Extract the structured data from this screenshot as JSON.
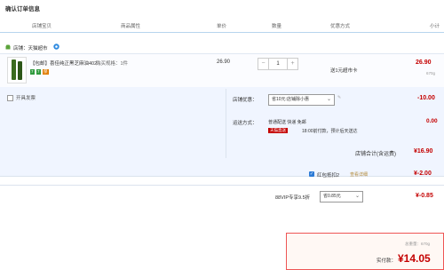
{
  "page": {
    "title": "确认订单信息"
  },
  "table_header": {
    "col_shop": "店铺宝贝",
    "col_attr": "商品属性",
    "col_price": "单价",
    "col_qty": "数量",
    "col_promo": "优惠方式",
    "col_subtotal": "小计"
  },
  "shop": {
    "label": "店铺：天猫超市"
  },
  "item": {
    "name": "【包邮】喜佳纯正黑芝麻油402...",
    "spec": "购买规格：1件",
    "badges": [
      "7",
      "7",
      "保"
    ],
    "price": "26.90",
    "qty": "1",
    "promo": "送1元超市卡",
    "subtotal": "26.90",
    "weight": "670g"
  },
  "options": {
    "invoice": "开具发票",
    "shop_discount_label": "店铺优惠：",
    "shop_discount_value": "省10元:店铺除小惠",
    "shop_discount_amount": "-10.00",
    "shipping_label": "运送方式：",
    "shipping_line1": "普通配送 快递 免邮",
    "shipping_tag": "天猫直送",
    "shipping_line2": "18:00前付款，预计后天送达",
    "shipping_fee": "0.00"
  },
  "shop_total": {
    "label": "店铺合计(含运费)",
    "value": "¥16.90"
  },
  "redpacket": {
    "label": "红包抵扣2",
    "sub": "查看详细",
    "value": "¥-2.00"
  },
  "vip": {
    "label": "88VIP专享9.5折",
    "select": "省0.85元",
    "value": "¥-0.85"
  },
  "summary": {
    "weight": "总重量：670g",
    "pay_label": "实付款：",
    "pay_value": "¥14.05"
  }
}
